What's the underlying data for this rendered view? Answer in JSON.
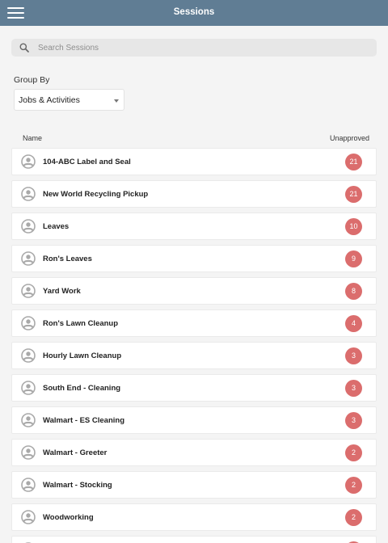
{
  "header": {
    "title": "Sessions"
  },
  "search": {
    "placeholder": "Search Sessions",
    "value": ""
  },
  "group_by": {
    "label": "Group By",
    "selected": "Jobs & Activities"
  },
  "columns": {
    "name": "Name",
    "unapproved": "Unapproved"
  },
  "colors": {
    "header_bg": "#607d94",
    "badge": "#db6d6d",
    "avatar": "#a9a9a9"
  },
  "icons": {
    "menu": "hamburger-menu-icon",
    "search": "search-icon",
    "row": "person-circle-icon"
  },
  "sessions": [
    {
      "name": "104-ABC Label and Seal",
      "unapproved": "21"
    },
    {
      "name": "New World Recycling Pickup",
      "unapproved": "21"
    },
    {
      "name": "Leaves",
      "unapproved": "10"
    },
    {
      "name": "Ron's Leaves",
      "unapproved": "9"
    },
    {
      "name": "Yard Work",
      "unapproved": "8"
    },
    {
      "name": "Ron's Lawn Cleanup",
      "unapproved": "4"
    },
    {
      "name": "Hourly Lawn Cleanup",
      "unapproved": "3"
    },
    {
      "name": "South End - Cleaning",
      "unapproved": "3"
    },
    {
      "name": "Walmart - ES Cleaning",
      "unapproved": "3"
    },
    {
      "name": "Walmart - Greeter",
      "unapproved": "2"
    },
    {
      "name": "Walmart - Stocking",
      "unapproved": "2"
    },
    {
      "name": "Woodworking",
      "unapproved": "2"
    },
    {
      "name": "",
      "unapproved": ""
    }
  ]
}
